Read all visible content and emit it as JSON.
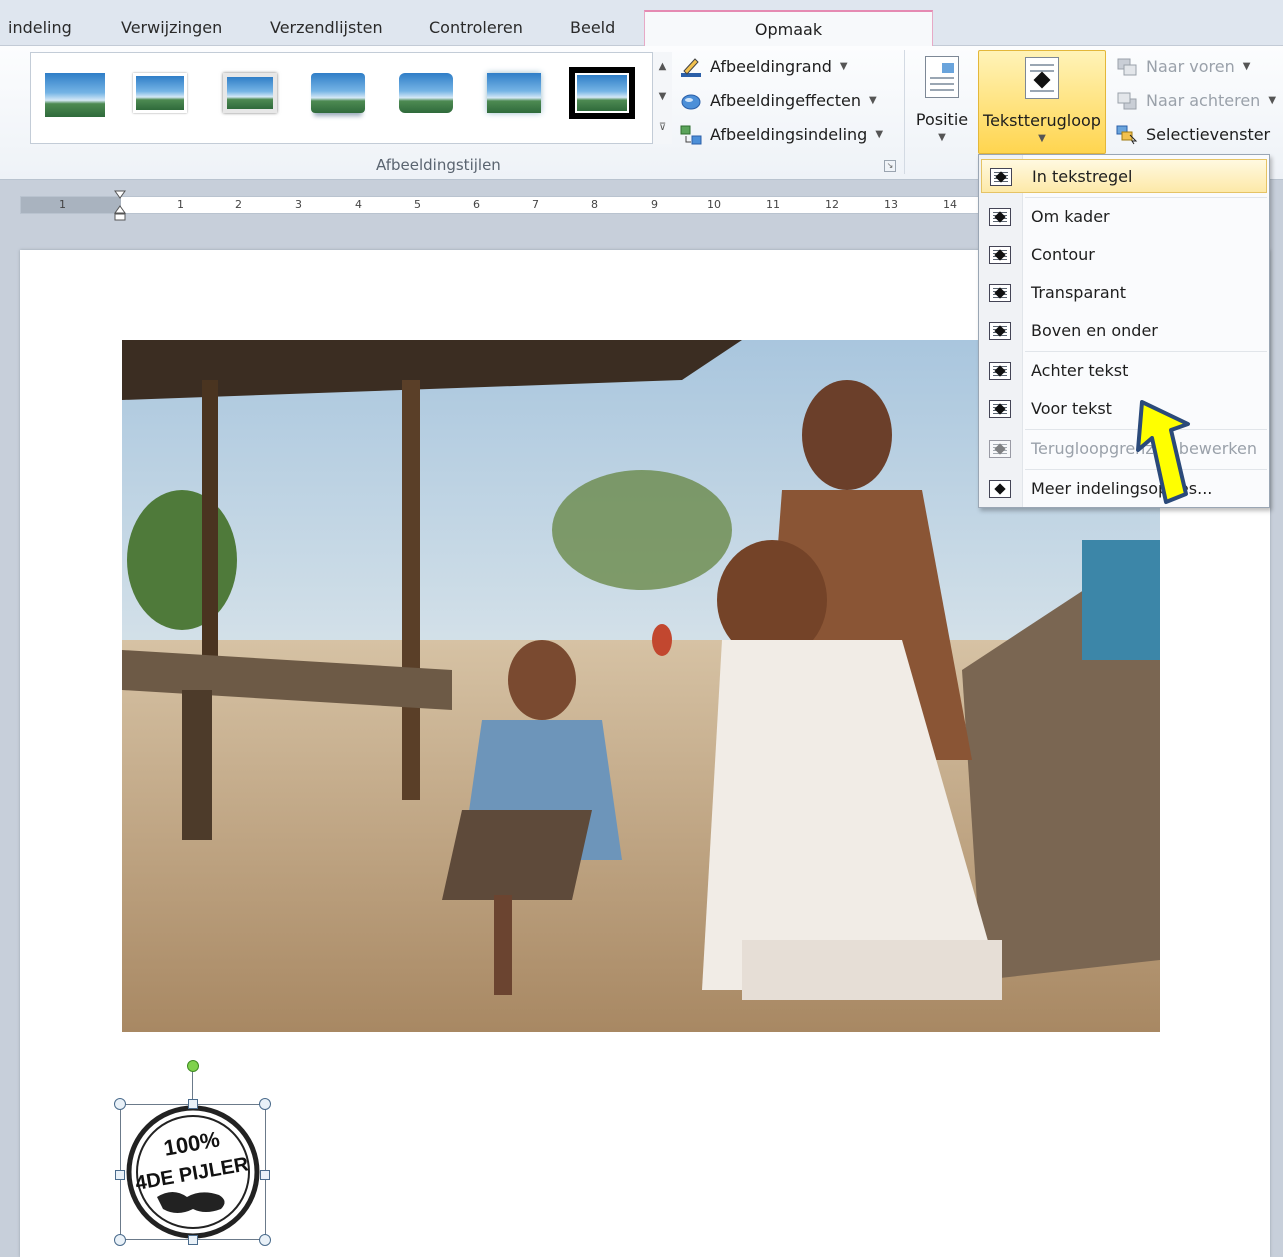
{
  "tabs": [
    "indeling",
    "Verwijzingen",
    "Verzendlijsten",
    "Controleren",
    "Beeld",
    "Opmaak"
  ],
  "ribbon": {
    "picture_style_group": "Afbeeldingstijlen",
    "picture_border": "Afbeeldingrand",
    "picture_effects": "Afbeeldingeffecten",
    "picture_layout": "Afbeeldingsindeling",
    "position": "Positie",
    "wrap_text": "Tekstterugloop",
    "bring_forward": "Naar voren",
    "send_backward": "Naar achteren",
    "selection_pane": "Selectievenster"
  },
  "ruler_numbers": [
    "1",
    "1",
    "2",
    "3",
    "4",
    "5",
    "6",
    "7",
    "8",
    "9",
    "10",
    "11",
    "12",
    "13",
    "14"
  ],
  "wrap_menu": {
    "items": [
      {
        "label": "In tekstregel",
        "state": "selected"
      },
      {
        "label": "Om kader",
        "state": "enabled"
      },
      {
        "label": "Contour",
        "state": "enabled"
      },
      {
        "label": "Transparant",
        "state": "enabled"
      },
      {
        "label": "Boven en onder",
        "state": "enabled"
      },
      {
        "label": "Achter tekst",
        "state": "enabled"
      },
      {
        "label": "Voor tekst",
        "state": "enabled"
      },
      {
        "label": "Terugloopgrenzen bewerken",
        "state": "disabled"
      },
      {
        "label": "Meer indelingsopties...",
        "state": "enabled"
      }
    ]
  },
  "logo": {
    "line1": "100%",
    "line2": "4DE PIJLER"
  },
  "colors": {
    "accent_tab": "#e58ab2",
    "highlight": "#ffd54f",
    "arrow": "#ffff00",
    "arrow_outline": "#2b4a7a"
  }
}
